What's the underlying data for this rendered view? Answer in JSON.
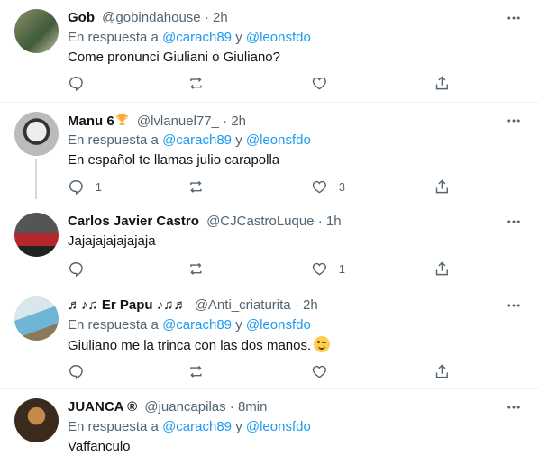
{
  "tweets": [
    {
      "name": "Gob",
      "handle": "@gobindahouse",
      "time": "2h",
      "replying_prefix": "En respuesta a",
      "mention1": "@carach89",
      "conj": "y",
      "mention2": "@leonsfdo",
      "text": "Come pronunci Giuliani o Giuliano?",
      "replies": "",
      "retweets": "",
      "likes": ""
    },
    {
      "name": "Manu 6",
      "handle": "@lvlanuel77_",
      "time": "2h",
      "replying_prefix": "En respuesta a",
      "mention1": "@carach89",
      "conj": "y",
      "mention2": "@leonsfdo",
      "text": "En español te llamas julio carapolla",
      "replies": "1",
      "retweets": "",
      "likes": "3"
    },
    {
      "name": "Carlos Javier Castro",
      "handle": "@CJCastroLuque",
      "time": "1h",
      "text": "Jajajajajajajaja",
      "replies": "",
      "retweets": "",
      "likes": "1"
    },
    {
      "name": "♬♪♫ Er Papu ♪♫♬",
      "handle": "@Anti_criaturita",
      "time": "2h",
      "replying_prefix": "En respuesta a",
      "mention1": "@carach89",
      "conj": "y",
      "mention2": "@leonsfdo",
      "text": "Giuliano me la trinca con las dos manos.",
      "replies": "",
      "retweets": "",
      "likes": ""
    },
    {
      "name": "JUANCA ®",
      "handle": "@juancapilas",
      "time": "8min",
      "replying_prefix": "En respuesta a",
      "mention1": "@carach89",
      "conj": "y",
      "mention2": "@leonsfdo",
      "text": "Vaffanculo"
    }
  ],
  "dot": "·",
  "icons": {
    "reply": "reply-icon",
    "retweet": "retweet-icon",
    "like": "heart-icon",
    "share": "share-icon",
    "more": "more-icon",
    "trophy": "trophy-icon",
    "emoji": "winking-face-emoji"
  },
  "colors": {
    "link": "#1d9bf0",
    "muted": "#536471",
    "text": "#0f1419",
    "separator": "#eff3f4"
  }
}
